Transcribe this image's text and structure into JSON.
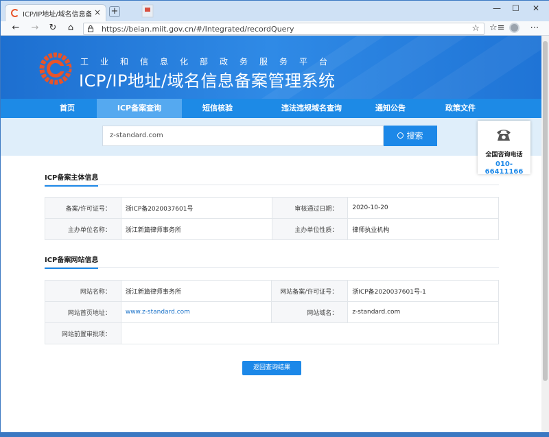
{
  "browser": {
    "tab_title": "ICP/IP地址/域名信息备案管理系",
    "tab_close": "×",
    "new_tab": "+",
    "minimize": "—",
    "maximize": "☐",
    "close": "✕",
    "back": "←",
    "forward": "→",
    "reload": "↻",
    "home": "⌂",
    "url": "https://beian.miit.gov.cn/#/Integrated/recordQuery",
    "favorite": "☆",
    "collections": "☆≡",
    "menu": "⋯"
  },
  "header": {
    "subtitle": "工业和信息化部政务服务平台",
    "title": "ICP/IP地址/域名信息备案管理系统"
  },
  "nav": {
    "items": [
      {
        "label": "首页"
      },
      {
        "label": "ICP备案查询"
      },
      {
        "label": "短信核验"
      },
      {
        "label": "违法违规域名查询"
      },
      {
        "label": "通知公告"
      },
      {
        "label": "政策文件"
      }
    ]
  },
  "search": {
    "value": "z-standard.com",
    "button_label": "搜索"
  },
  "hotline": {
    "label": "全国咨询电话",
    "number": "010-66411166"
  },
  "subject_section": {
    "title": "ICP备案主体信息",
    "rows": [
      {
        "label1": "备案/许可证号：",
        "value1": "浙ICP备2020037601号",
        "label2": "审核通过日期：",
        "value2": "2020-10-20"
      },
      {
        "label1": "主办单位名称：",
        "value1": "浙江新篇律师事务所",
        "label2": "主办单位性质：",
        "value2": "律师执业机构"
      }
    ]
  },
  "website_section": {
    "title": "ICP备案网站信息",
    "rows": [
      {
        "label1": "网站名称：",
        "value1": "浙江新篇律师事务所",
        "label2": "网站备案/许可证号：",
        "value2": "浙ICP备2020037601号-1"
      },
      {
        "label1": "网站首页地址：",
        "value1": "www.z-standard.com",
        "label2": "网站域名：",
        "value2": "z-standard.com"
      },
      {
        "label1": "网站前置审批项：",
        "value1": ""
      }
    ]
  },
  "back_button": "返回查询结果",
  "colors": {
    "brand_blue": "#1c88e8",
    "nav_active": "#55a9f0",
    "link": "#1c73c9"
  }
}
